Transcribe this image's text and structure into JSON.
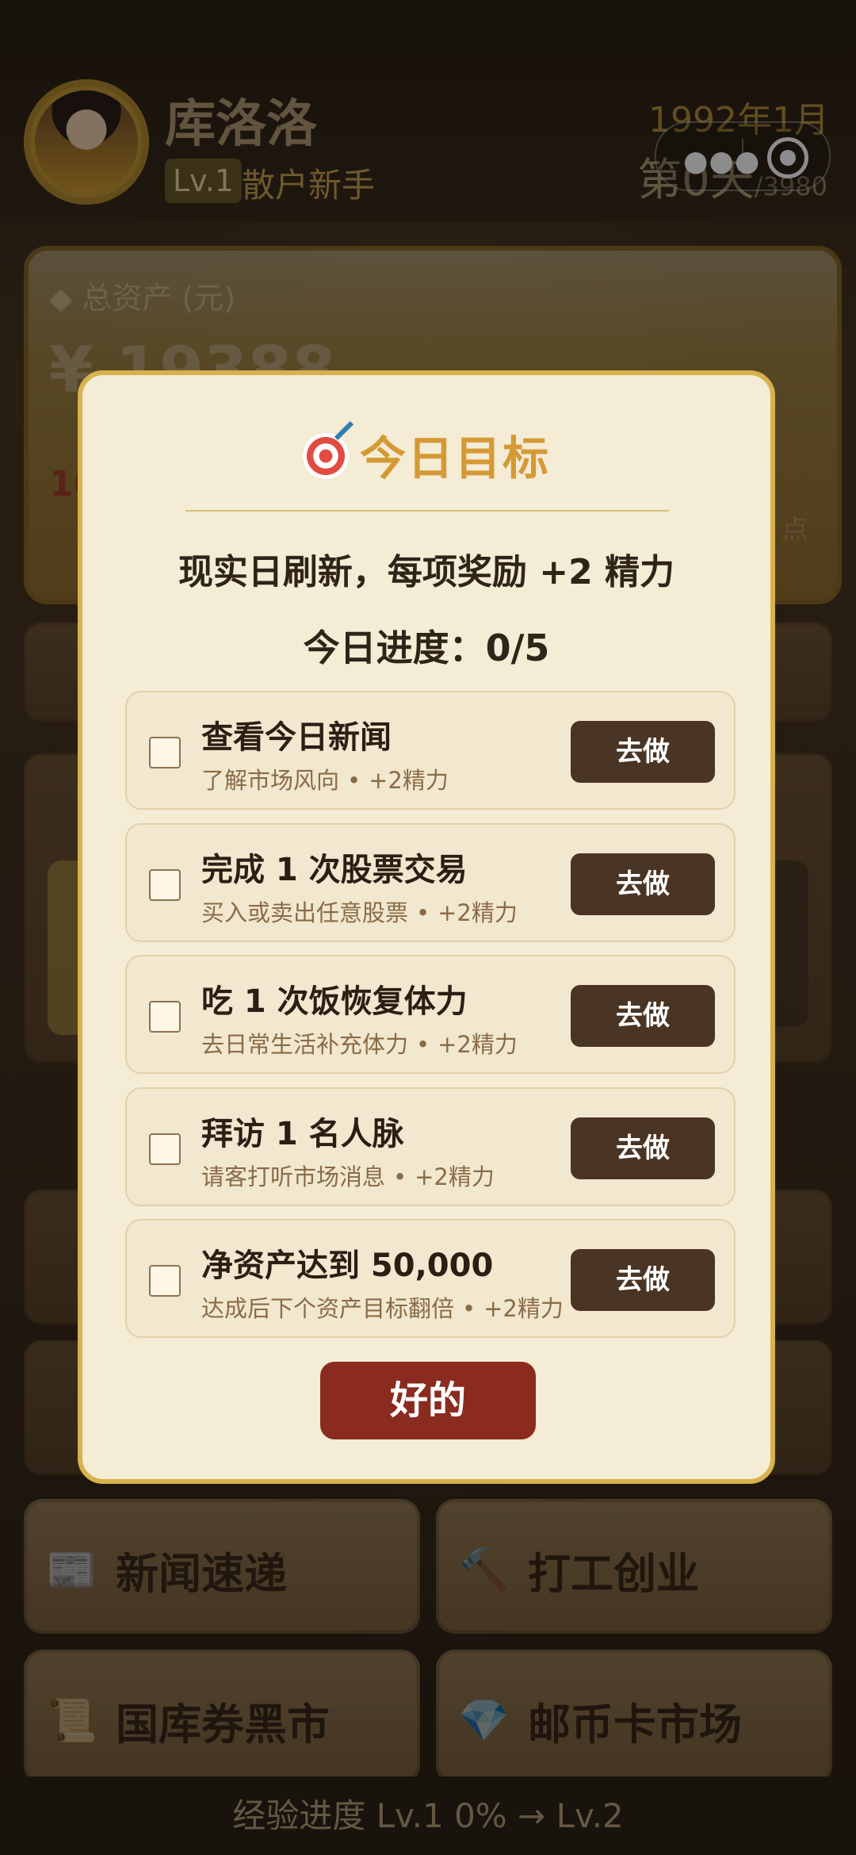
{
  "header": {
    "username": "库洛洛",
    "level": "Lv.1",
    "level_title": "散户新手",
    "date": "1992年1月",
    "day": "第0天",
    "day_suffix": "/3980"
  },
  "asset_card": {
    "label": "◆ 总资产 (元)",
    "value": "¥ 19388",
    "red_value": "10",
    "point_label": "点"
  },
  "tiles": [
    {
      "label": "新闻速递",
      "icon": "newspaper-icon"
    },
    {
      "label": "打工创业",
      "icon": "hammer-icon"
    },
    {
      "label": "国库券黑市",
      "icon": "scroll-icon"
    },
    {
      "label": "邮币卡市场",
      "icon": "diamond-icon"
    }
  ],
  "footer": {
    "exp_text": "经验进度  Lv.1  0% → Lv.2",
    "exp_progress": 0
  },
  "modal": {
    "title": "今日目标",
    "subtitle": "现实日刷新，每项奖励 +2 精力",
    "progress": "今日进度：0/5",
    "tasks": [
      {
        "title": "查看今日新闻",
        "desc": "了解市场风向",
        "reward": "+2精力",
        "button": "去做",
        "checked": false
      },
      {
        "title": "完成 1 次股票交易",
        "desc": "买入或卖出任意股票",
        "reward": "+2精力",
        "button": "去做",
        "checked": false
      },
      {
        "title": "吃 1 次饭恢复体力",
        "desc": "去日常生活补充体力",
        "reward": "+2精力",
        "button": "去做",
        "checked": false
      },
      {
        "title": "拜访 1 名人脉",
        "desc": "请客打听市场消息",
        "reward": "+2精力",
        "button": "去做",
        "checked": false
      },
      {
        "title": "净资产达到 50,000",
        "desc": "达成后下个资产目标翻倍",
        "reward": "+2精力",
        "button": "去做",
        "checked": false
      }
    ],
    "ok_button": "好的"
  },
  "colors": {
    "accent_gold": "#d59a35",
    "button_dark": "#4a3423",
    "ok_red": "#8b2b1f",
    "modal_bg": "#f5ecd6"
  }
}
